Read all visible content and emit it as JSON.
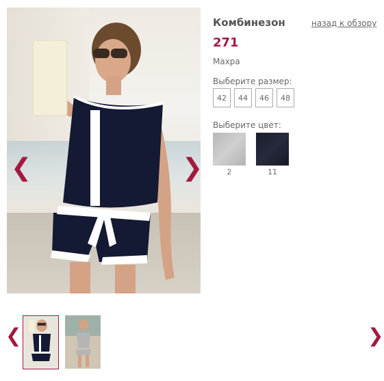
{
  "product": {
    "title": "Комбинезон",
    "back_link": "назад к обзору",
    "price": "271",
    "material": "Махра"
  },
  "size_selector": {
    "label": "Выберите размер:",
    "sizes": [
      "42",
      "44",
      "46",
      "48"
    ]
  },
  "color_selector": {
    "label": "Выберите цвет:",
    "colors": [
      {
        "code": "2",
        "swatch": "#c0c0c0"
      },
      {
        "code": "11",
        "swatch": "#1f2232"
      }
    ]
  },
  "gallery": {
    "prev_glyph": "❮",
    "next_glyph": "❯"
  },
  "colors": {
    "accent": "#a31940",
    "text": "#555555",
    "garment_navy": "#141a33"
  }
}
